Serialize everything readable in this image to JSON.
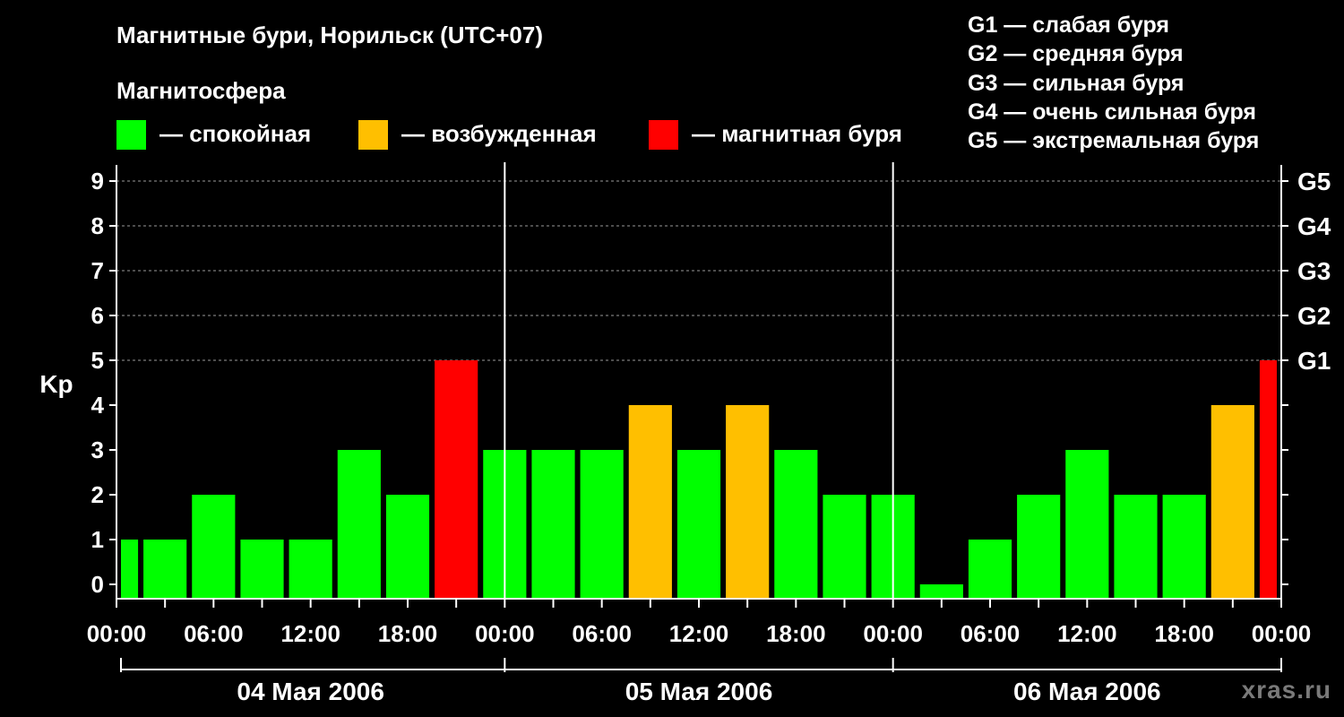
{
  "header": {
    "title": "Магнитные бури, Норильск (UTC+07)",
    "legend_title": "Магнитосфера"
  },
  "legend": [
    {
      "label": "— спокойная",
      "color": "#00ff00"
    },
    {
      "label": "— возбужденная",
      "color": "#ffbf00"
    },
    {
      "label": "— магнитная буря",
      "color": "#ff0000"
    }
  ],
  "g_scale": [
    "G1 — слабая буря",
    "G2 — средняя буря",
    "G3 — сильная буря",
    "G4 — очень сильная буря",
    "G5 — экстремальная буря"
  ],
  "watermark": "xras.ru",
  "chart_data": {
    "type": "bar",
    "ylabel": "Kp",
    "ylim": [
      0,
      9
    ],
    "yticks": [
      0,
      1,
      2,
      3,
      4,
      5,
      6,
      7,
      8,
      9
    ],
    "right_ticks": [
      {
        "value": 5,
        "label": "G1"
      },
      {
        "value": 6,
        "label": "G2"
      },
      {
        "value": 7,
        "label": "G3"
      },
      {
        "value": 8,
        "label": "G4"
      },
      {
        "value": 9,
        "label": "G5"
      }
    ],
    "grid": "dashed horizontal at Kp 5–9",
    "xtick_labels": [
      "00:00",
      "06:00",
      "12:00",
      "18:00",
      "00:00",
      "06:00",
      "12:00",
      "18:00",
      "00:00",
      "06:00",
      "12:00",
      "18:00",
      "00:00"
    ],
    "days": [
      "04 Мая 2006",
      "05 Мая 2006",
      "06 Мая 2006"
    ],
    "interval_hours": 3,
    "colors": {
      "quiet": "#00ff00",
      "active": "#ffbf00",
      "storm": "#ff0000"
    },
    "kp_values": [
      1,
      1,
      2,
      1,
      1,
      3,
      2,
      5,
      3,
      3,
      3,
      4,
      3,
      4,
      3,
      2,
      2,
      0,
      1,
      2,
      3,
      2,
      2,
      4,
      5
    ],
    "bar_status": [
      "quiet",
      "quiet",
      "quiet",
      "quiet",
      "quiet",
      "quiet",
      "quiet",
      "storm",
      "quiet",
      "quiet",
      "quiet",
      "active",
      "quiet",
      "active",
      "quiet",
      "quiet",
      "quiet",
      "quiet",
      "quiet",
      "quiet",
      "quiet",
      "quiet",
      "quiet",
      "active",
      "storm"
    ]
  }
}
